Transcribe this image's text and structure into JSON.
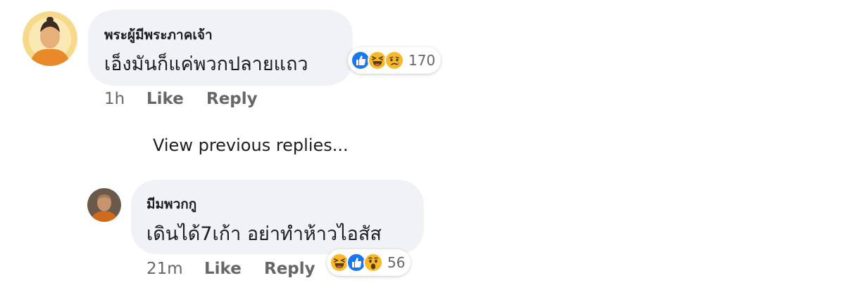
{
  "comment": {
    "author": "พระผู้มีพระภาคเจ้า",
    "text": "เอ็งมันก็แค่พวกปลายแถว",
    "time": "1h",
    "like_label": "Like",
    "reply_label": "Reply",
    "reactions": [
      "like-icon",
      "haha-icon",
      "sad-icon"
    ],
    "reaction_count": "170"
  },
  "view_previous_replies": "View previous replies...",
  "reply": {
    "author": "มีมพวกกู",
    "text": "เดินได้7เก้า อย่าทำห้าวไอสัส",
    "time": "21m",
    "like_label": "Like",
    "reply_label": "Reply",
    "reactions": [
      "haha-icon",
      "like-icon",
      "wow-icon"
    ],
    "reaction_count": "56"
  },
  "colors": {
    "bubble": "#f0f2f5",
    "meta_text": "#65676b",
    "like_blue": "#1877f2",
    "emoji_yellow": "#f7b928"
  }
}
